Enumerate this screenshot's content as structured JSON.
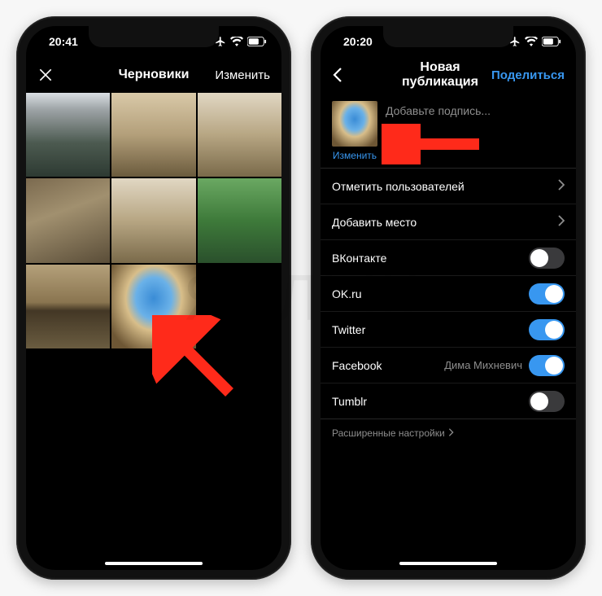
{
  "watermark": "ЯБЛЫК",
  "phone_left": {
    "status": {
      "time": "20:41"
    },
    "nav": {
      "title": "Черновики",
      "right_action": "Изменить"
    }
  },
  "phone_right": {
    "status": {
      "time": "20:20"
    },
    "nav": {
      "title": "Новая публикация",
      "right_action": "Поделиться"
    },
    "compose": {
      "caption_placeholder": "Добавьте подпись...",
      "edit_label": "Изменить"
    },
    "rows": {
      "tag_users": "Отметить пользователей",
      "add_location": "Добавить место",
      "vk": "ВКонтакте",
      "okru": "OK.ru",
      "twitter": "Twitter",
      "facebook": "Facebook",
      "facebook_sub": "Дима Михневич",
      "tumblr": "Tumblr",
      "advanced": "Расширенные настройки"
    },
    "toggles": {
      "vk": false,
      "okru": true,
      "twitter": true,
      "facebook": true,
      "tumblr": false
    }
  }
}
